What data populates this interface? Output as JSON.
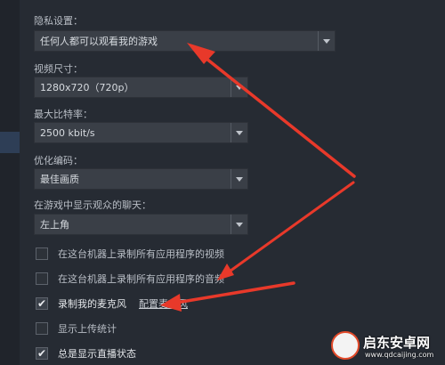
{
  "settings": {
    "privacy": {
      "label": "隐私设置：",
      "value": "任何人都可以观看我的游戏"
    },
    "video_size": {
      "label": "视频尺寸：",
      "value": "1280x720（720p）"
    },
    "max_bitrate": {
      "label": "最大比特率：",
      "value": "2500 kbit/s"
    },
    "encoding": {
      "label": "优化编码：",
      "value": "最佳画质"
    },
    "chat_position": {
      "label": "在游戏中显示观众的聊天：",
      "value": "左上角"
    }
  },
  "checkboxes": [
    {
      "label": "在这台机器上录制所有应用程序的视频",
      "checked": false
    },
    {
      "label": "在这台机器上录制所有应用程序的音频",
      "checked": false
    },
    {
      "label": "录制我的麦克风",
      "checked": true,
      "link": "配置麦克风"
    },
    {
      "label": "显示上传统计",
      "checked": false
    },
    {
      "label": "总是显示直播状态",
      "checked": true
    }
  ],
  "watermark": {
    "name": "启东安卓网",
    "url": "www.qdcaijing.com"
  },
  "colors": {
    "arrow": "#e8392a",
    "background": "#262b33",
    "dropdown": "#3a3f47"
  }
}
